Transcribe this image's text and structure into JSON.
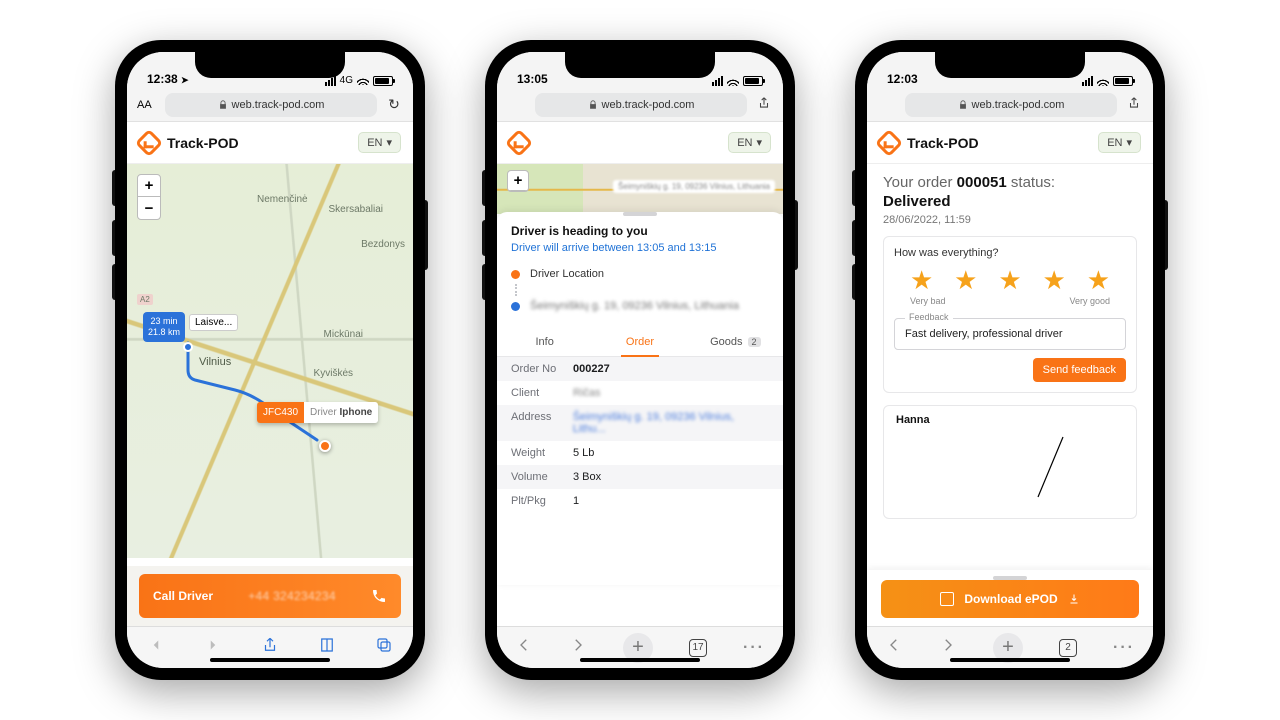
{
  "common": {
    "url": "web.track-pod.com",
    "brand": "Track-POD",
    "lang": "EN"
  },
  "phone1": {
    "time": "12:38",
    "net": "4G",
    "url_aa": "AA",
    "map": {
      "eta_time": "23 min",
      "eta_dist": "21.8 km",
      "dest_short": "Laisve...",
      "driver_code": "JFC430",
      "driver_label_prefix": "Driver",
      "driver_name": "Iphone",
      "city_vilnius": "Vilnius",
      "city_nemencine": "Nemenčinė",
      "city_skersabaliai": "Skersabaliai",
      "city_mickunai": "Mickūnai",
      "city_kyviskes": "Kyviškės",
      "city_bezdonys": "Bezdonys"
    },
    "call": {
      "label": "Call Driver",
      "number": "+44 324234234"
    }
  },
  "phone2": {
    "time": "13:05",
    "sheet_title": "Driver is heading to you",
    "eta_line": "Driver will arrive between 13:05 and 13:15",
    "legend_driver": "Driver Location",
    "legend_dest": "Šeimyniškių g. 19, 09236 Vilnius, Lithuania",
    "tabs": {
      "info": "Info",
      "order": "Order",
      "goods": "Goods",
      "goods_count": "2"
    },
    "rows": {
      "order_no_k": "Order No",
      "order_no_v": "000227",
      "client_k": "Client",
      "client_v": "Ričas",
      "address_k": "Address",
      "address_v": "Šeimyniškių g. 19, 09236 Vilnius, Lithu...",
      "weight_k": "Weight",
      "weight_v": "5 Lb",
      "volume_k": "Volume",
      "volume_v": "3 Box",
      "plt_k": "Plt/Pkg",
      "plt_v": "1"
    },
    "safari_tabs": "17"
  },
  "phone3": {
    "time": "12:03",
    "status_prefix": "Your order",
    "order_no": "000051",
    "status_suffix": "status:",
    "status_value": "Delivered",
    "timestamp": "28/06/2022, 11:59",
    "question": "How was everything?",
    "scale_low": "Very bad",
    "scale_high": "Very good",
    "feedback_legend": "Feedback",
    "feedback_text": "Fast delivery, professional driver",
    "send_btn": "Send feedback",
    "signer": "Hanna",
    "download": "Download ePOD",
    "safari_tabs": "2"
  }
}
